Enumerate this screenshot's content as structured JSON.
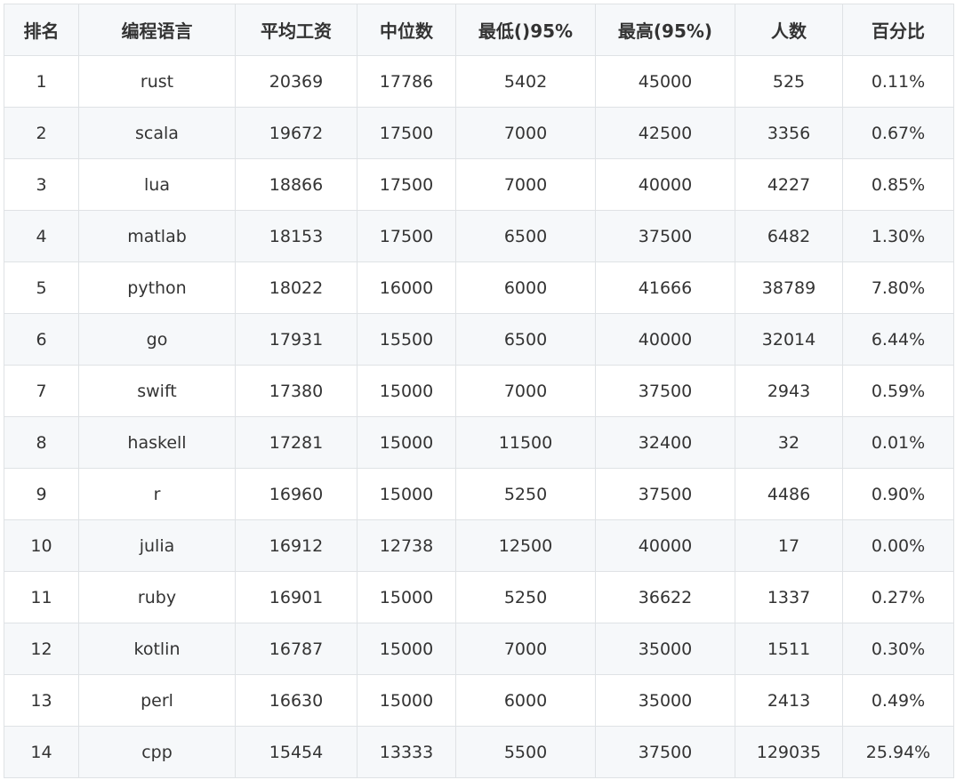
{
  "table": {
    "headers": [
      "排名",
      "编程语言",
      "平均工资",
      "中位数",
      "最低()95%",
      "最高(95%)",
      "人数",
      "百分比"
    ],
    "rows": [
      [
        "1",
        "rust",
        "20369",
        "17786",
        "5402",
        "45000",
        "525",
        "0.11%"
      ],
      [
        "2",
        "scala",
        "19672",
        "17500",
        "7000",
        "42500",
        "3356",
        "0.67%"
      ],
      [
        "3",
        "lua",
        "18866",
        "17500",
        "7000",
        "40000",
        "4227",
        "0.85%"
      ],
      [
        "4",
        "matlab",
        "18153",
        "17500",
        "6500",
        "37500",
        "6482",
        "1.30%"
      ],
      [
        "5",
        "python",
        "18022",
        "16000",
        "6000",
        "41666",
        "38789",
        "7.80%"
      ],
      [
        "6",
        "go",
        "17931",
        "15500",
        "6500",
        "40000",
        "32014",
        "6.44%"
      ],
      [
        "7",
        "swift",
        "17380",
        "15000",
        "7000",
        "37500",
        "2943",
        "0.59%"
      ],
      [
        "8",
        "haskell",
        "17281",
        "15000",
        "11500",
        "32400",
        "32",
        "0.01%"
      ],
      [
        "9",
        "r",
        "16960",
        "15000",
        "5250",
        "37500",
        "4486",
        "0.90%"
      ],
      [
        "10",
        "julia",
        "16912",
        "12738",
        "12500",
        "40000",
        "17",
        "0.00%"
      ],
      [
        "11",
        "ruby",
        "16901",
        "15000",
        "5250",
        "36622",
        "1337",
        "0.27%"
      ],
      [
        "12",
        "kotlin",
        "16787",
        "15000",
        "7000",
        "35000",
        "1511",
        "0.30%"
      ],
      [
        "13",
        "perl",
        "16630",
        "15000",
        "6000",
        "35000",
        "2413",
        "0.49%"
      ],
      [
        "14",
        "cpp",
        "15454",
        "13333",
        "5500",
        "37500",
        "129035",
        "25.94%"
      ]
    ]
  }
}
